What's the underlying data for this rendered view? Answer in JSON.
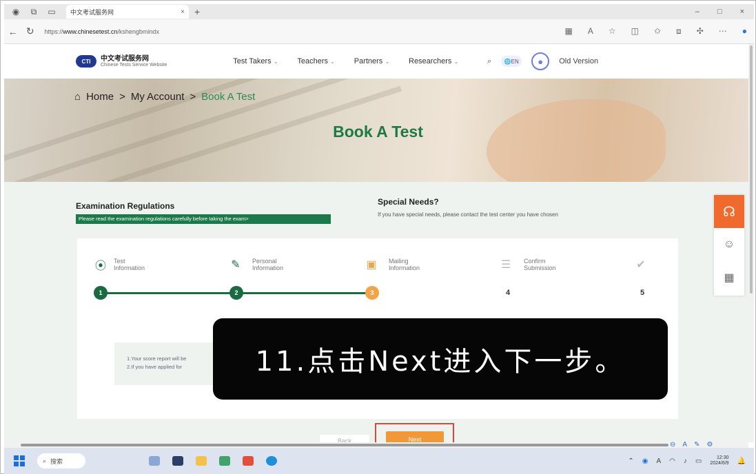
{
  "browser": {
    "tab_title": "中文考试服务网",
    "tab_close": "×",
    "new_tab": "+",
    "url_prefix": "https://",
    "url_host": "www.chinesetest.cn",
    "url_path": "/kshengbmindx",
    "window_controls": [
      "–",
      "□",
      "×"
    ]
  },
  "site": {
    "logo_mark": "CTI",
    "logo_cn": "中文考试服务网",
    "logo_en": "Chinese Tests Service Website",
    "nav": [
      "Test Takers",
      "Teachers",
      "Partners",
      "Researchers"
    ],
    "lang_label": "EN",
    "old_version": "Old Version"
  },
  "breadcrumb": {
    "home": "Home",
    "sep": ">",
    "account": "My Account",
    "current": "Book A Test"
  },
  "page_title": "Book A Test",
  "regulations": {
    "title": "Examination Regulations",
    "note": "Please read the examination regulations carefully before taking the exam>"
  },
  "special_needs": {
    "title": "Special Needs?",
    "text": "If you have special needs, please contact the test center you have chosen"
  },
  "steps": [
    {
      "label_1": "Test",
      "label_2": "Information",
      "number": "1",
      "state": "done"
    },
    {
      "label_1": "Personal",
      "label_2": "Information",
      "number": "2",
      "state": "done"
    },
    {
      "label_1": "Mailing",
      "label_2": "Information",
      "number": "3",
      "state": "active"
    },
    {
      "label_1": "Confirm",
      "label_2": "Submission",
      "number": "4",
      "state": "todo"
    },
    {
      "label_1": "",
      "label_2": "",
      "number": "5",
      "state": "todo"
    }
  ],
  "notice": {
    "line_1": "1.Your score report will be",
    "line_2": "2.If you have applied for"
  },
  "overlay_caption": "11.点击Next进入下一步。",
  "buttons": {
    "back": "Back",
    "next": "Next"
  },
  "taskbar": {
    "search": "搜索",
    "time": "12:30",
    "date": "2024/6/9"
  },
  "colors": {
    "brand_green": "#1b6b41",
    "active_orange": "#f3a348",
    "next_orange": "#f19838",
    "highlight_red": "#e04434"
  }
}
